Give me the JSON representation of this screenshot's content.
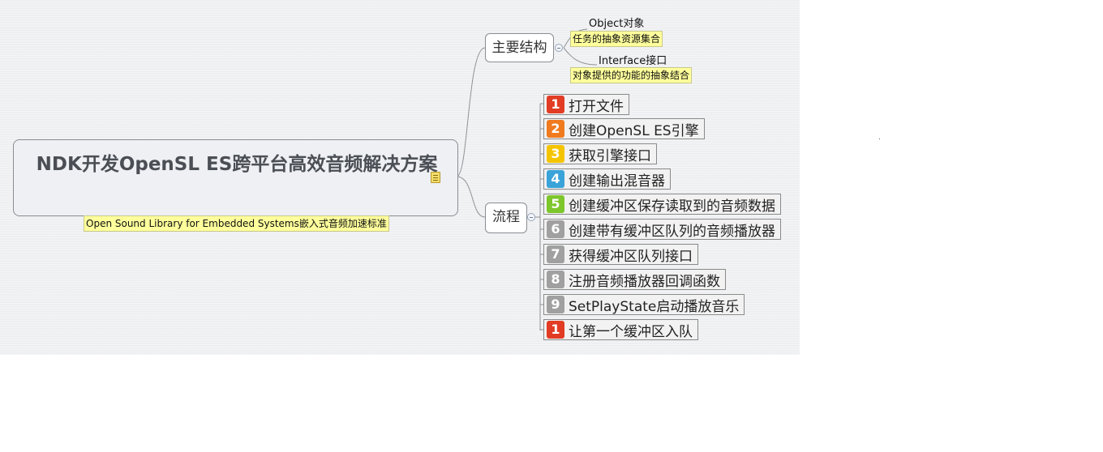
{
  "central": {
    "title": "NDK开发OpenSL ES跨平台高效音频解决方案",
    "note": "Open Sound Library for Embedded Systems嵌入式音频加速标准"
  },
  "branches": {
    "structure": {
      "label": "主要结构",
      "children": [
        {
          "label": "Object对象",
          "note": "任务的抽象资源集合"
        },
        {
          "label": "Interface接口",
          "note": "对象提供的功能的抽象结合"
        }
      ]
    },
    "flow": {
      "label": "流程",
      "steps": [
        {
          "num": "1",
          "label": "打开文件",
          "color": "#e23c24"
        },
        {
          "num": "2",
          "label": "创建OpenSL ES引擎",
          "color": "#f07a1e"
        },
        {
          "num": "3",
          "label": "获取引擎接口",
          "color": "#f5c400"
        },
        {
          "num": "4",
          "label": "创建输出混音器",
          "color": "#3aa3d9"
        },
        {
          "num": "5",
          "label": "创建缓冲区保存读取到的音频数据",
          "color": "#7dc62b"
        },
        {
          "num": "6",
          "label": "创建带有缓冲区队列的音频播放器",
          "color": "#a0a0a0"
        },
        {
          "num": "7",
          "label": "获得缓冲区队列接口",
          "color": "#a0a0a0"
        },
        {
          "num": "8",
          "label": "注册音频播放器回调函数",
          "color": "#a0a0a0"
        },
        {
          "num": "9",
          "label": "SetPlayState启动播放音乐",
          "color": "#a0a0a0"
        },
        {
          "num": "1",
          "label": "让第一个缓冲区入队",
          "color": "#e23c24"
        }
      ]
    }
  },
  "icons": {
    "note": "note-icon",
    "collapse": "collapse-minus-icon"
  }
}
